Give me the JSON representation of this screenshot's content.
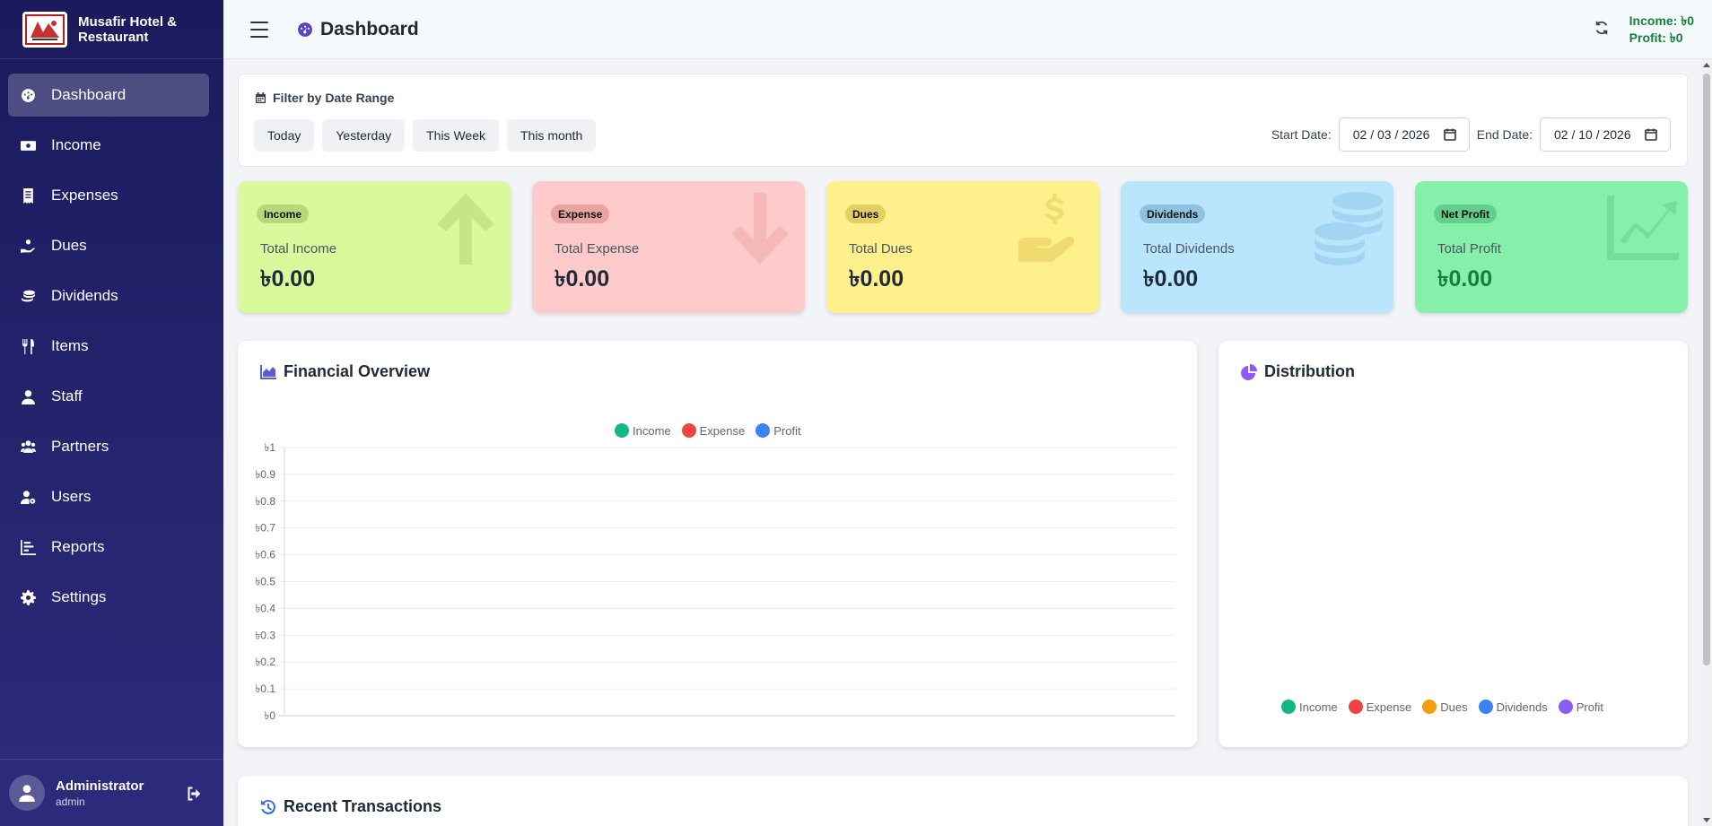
{
  "brand": {
    "name": "Musafir Hotel & Restaurant"
  },
  "sidebar": {
    "items": [
      {
        "label": "Dashboard",
        "icon": "dashboard-icon"
      },
      {
        "label": "Income",
        "icon": "money-icon"
      },
      {
        "label": "Expenses",
        "icon": "receipt-icon"
      },
      {
        "label": "Dues",
        "icon": "hand-coin-icon"
      },
      {
        "label": "Dividends",
        "icon": "coins-icon"
      },
      {
        "label": "Items",
        "icon": "utensils-icon"
      },
      {
        "label": "Staff",
        "icon": "user-icon"
      },
      {
        "label": "Partners",
        "icon": "users-icon"
      },
      {
        "label": "Users",
        "icon": "user-gear-icon"
      },
      {
        "label": "Reports",
        "icon": "bar-chart-icon"
      },
      {
        "label": "Settings",
        "icon": "gear-icon"
      }
    ],
    "user": {
      "name": "Administrator",
      "role": "admin"
    }
  },
  "header": {
    "title": "Dashboard",
    "income": "Income: ৳0",
    "profit": "Profit: ৳0"
  },
  "filter": {
    "title": "Filter by Date Range",
    "buttons": [
      "Today",
      "Yesterday",
      "This Week",
      "This month"
    ],
    "start_label": "Start Date:",
    "start_value": "02 / 03 / 2026",
    "end_label": "End Date:",
    "end_value": "02 / 10 / 2026"
  },
  "cards": [
    {
      "badge": "Income",
      "label": "Total Income",
      "value": "৳0.00",
      "bg": "#d9f99d",
      "badge_bg": "#b5d97a",
      "icon_color": "#a3c96a",
      "value_color": "#1f2937"
    },
    {
      "badge": "Expense",
      "label": "Total Expense",
      "value": "৳0.00",
      "bg": "#fecaca",
      "badge_bg": "#e8a3a3",
      "icon_color": "#e79a9a",
      "value_color": "#1f2937"
    },
    {
      "badge": "Dues",
      "label": "Total Dues",
      "value": "৳0.00",
      "bg": "#fef08a",
      "badge_bg": "#e3cf63",
      "icon_color": "#ddbb4a",
      "value_color": "#1f2937"
    },
    {
      "badge": "Dividends",
      "label": "Total Dividends",
      "value": "৳0.00",
      "bg": "#bae6fd",
      "badge_bg": "#8fc2e0",
      "icon_color": "#7fb7df",
      "value_color": "#1f2937"
    },
    {
      "badge": "Net Profit",
      "label": "Total Profit",
      "value": "৳0.00",
      "bg": "#86efac",
      "badge_bg": "#63cf8a",
      "icon_color": "#56c47e",
      "value_color": "#15803d"
    }
  ],
  "overview": {
    "title": "Financial Overview",
    "chart_data": {
      "type": "line",
      "ylim": [
        0,
        1
      ],
      "yticks": [
        "৳0",
        "৳0.1",
        "৳0.2",
        "৳0.3",
        "৳0.4",
        "৳0.5",
        "৳0.6",
        "৳0.7",
        "৳0.8",
        "৳0.9",
        "৳1"
      ],
      "series": [
        {
          "name": "Income",
          "color": "#10b981",
          "values": []
        },
        {
          "name": "Expense",
          "color": "#ef4444",
          "values": []
        },
        {
          "name": "Profit",
          "color": "#3b82f6",
          "values": []
        }
      ]
    }
  },
  "distribution": {
    "title": "Distribution",
    "chart_data": {
      "type": "pie",
      "series": [
        {
          "name": "Income",
          "color": "#10b981",
          "value": 0
        },
        {
          "name": "Expense",
          "color": "#ef4444",
          "value": 0
        },
        {
          "name": "Dues",
          "color": "#f59e0b",
          "value": 0
        },
        {
          "name": "Dividends",
          "color": "#3b82f6",
          "value": 0
        },
        {
          "name": "Profit",
          "color": "#8b5cf6",
          "value": 0
        }
      ]
    }
  },
  "recent": {
    "title": "Recent Transactions"
  },
  "colors": {
    "accent": "#5b40c8",
    "profit_green": "#15803d"
  }
}
